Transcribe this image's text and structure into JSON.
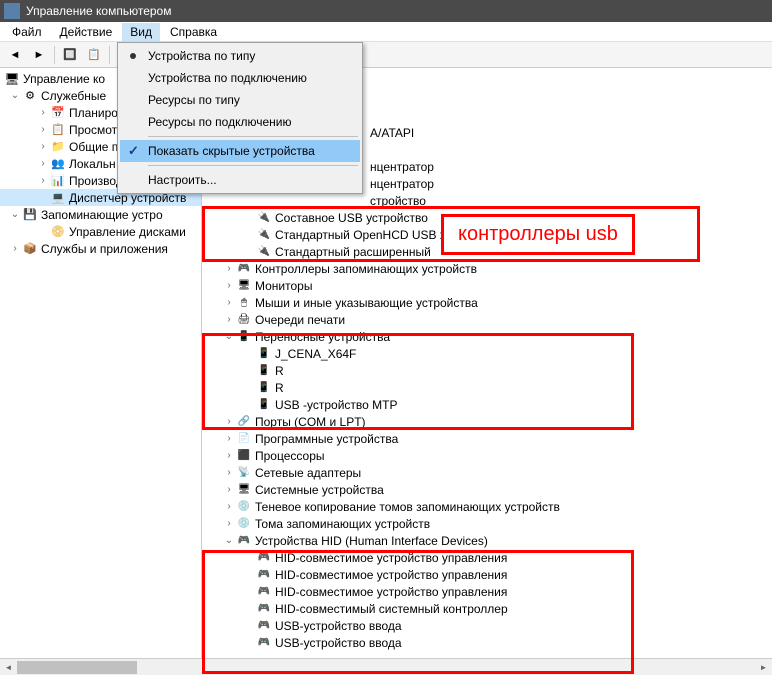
{
  "window": {
    "title": "Управление компьютером"
  },
  "menubar": {
    "file": "Файл",
    "action": "Действие",
    "view": "Вид",
    "help": "Справка"
  },
  "dropdown": {
    "by_type": "Устройства по типу",
    "by_conn": "Устройства по подключению",
    "res_type": "Ресурсы по типу",
    "res_conn": "Ресурсы по подключению",
    "show_hidden": "Показать скрытые устройства",
    "customize": "Настроить..."
  },
  "left_tree": {
    "root": "Управление ко",
    "services": "Служебные",
    "planner": "Планиро",
    "viewer": "Просмот",
    "shared": "Общие п",
    "local": "Локальн",
    "perf": "Производ",
    "devmgr": "Диспетчер устройств",
    "storage": "Запоминающие устро",
    "diskmgr": "Управление дисками",
    "apps": "Службы и приложения"
  },
  "right_tree": {
    "ide": "A/ATAPI",
    "hub1": "нцентратор",
    "hub2": "нцентратор",
    "dev_partial": "стройство",
    "composite": "Составное USB устройство",
    "openhcd": "Стандартный OpenHCD USB х",
    "extended": "Стандартный расширенный",
    "storage_ctrl": "Контроллеры запоминающих устройств",
    "monitors": "Мониторы",
    "mice": "Мыши и иные указывающие устройства",
    "print_queues": "Очереди печати",
    "portable": "Переносные устройства",
    "p1": "J_CENA_X64F",
    "p2": "R",
    "p3": "R",
    "p4": "USB -устройство MTP",
    "ports": "Порты (COM и LPT)",
    "software": "Программные устройства",
    "cpus": "Процессоры",
    "network": "Сетевые адаптеры",
    "system": "Системные устройства",
    "shadow": "Теневое копирование томов запоминающих устройств",
    "volumes": "Тома запоминающих устройств",
    "hid": "Устройства HID (Human Interface Devices)",
    "hid1": "HID-совместимое устройство управления",
    "hid2": "HID-совместимое устройство управления",
    "hid3": "HID-совместимое устройство управления",
    "hid4": "HID-совместимый системный контроллер",
    "hid5": "USB-устройство ввода",
    "hid6": "USB-устройство ввода"
  },
  "annotation": {
    "usb_controllers": "контроллеры usb"
  }
}
